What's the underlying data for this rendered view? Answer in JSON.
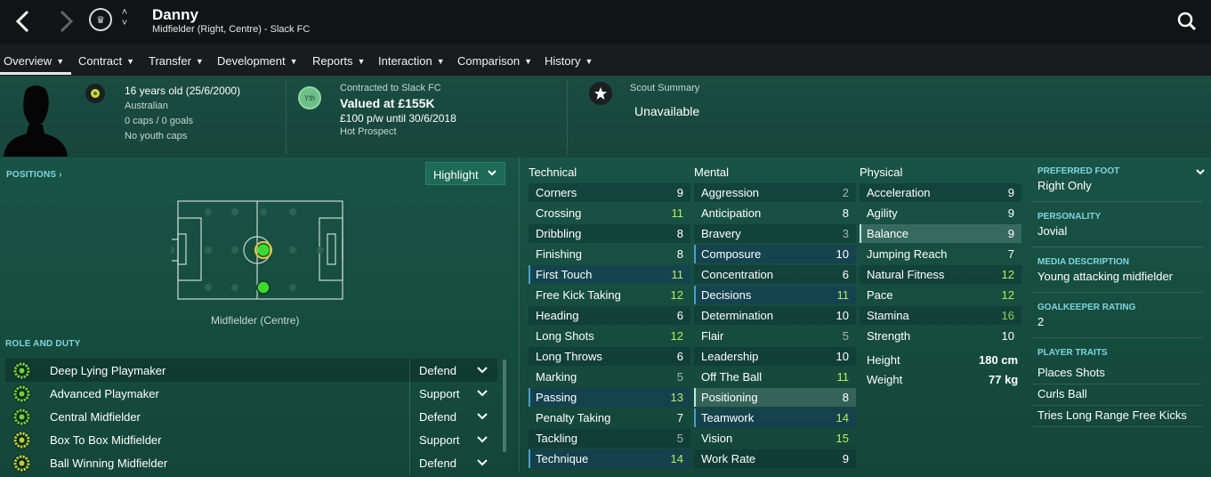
{
  "header": {
    "name": "Danny",
    "subtitle": "Midfielder (Right, Centre) - Slack FC"
  },
  "menu": [
    {
      "label": "Overview"
    },
    {
      "label": "Contract"
    },
    {
      "label": "Transfer"
    },
    {
      "label": "Development"
    },
    {
      "label": "Reports"
    },
    {
      "label": "Interaction"
    },
    {
      "label": "Comparison"
    },
    {
      "label": "History"
    }
  ],
  "info": {
    "age": "16 years old (25/6/2000)",
    "nationality": "Australian",
    "caps": "0 caps / 0 goals",
    "youth_caps": "No youth caps",
    "yth_badge": "Yth",
    "contract_label": "Contracted to Slack FC",
    "value": "Valued at £155K",
    "wage": "£100 p/w until 30/6/2018",
    "status": "Hot Prospect",
    "scout_label": "Scout Summary",
    "scout_value": "Unavailable"
  },
  "positions": {
    "title": "POSITIONS",
    "highlight_label": "Highlight",
    "position_label": "Midfielder (Centre)"
  },
  "roles": {
    "title": "ROLE AND DUTY",
    "items": [
      {
        "role": "Deep Lying Playmaker",
        "duty": "Defend"
      },
      {
        "role": "Advanced Playmaker",
        "duty": "Support"
      },
      {
        "role": "Central Midfielder",
        "duty": "Defend"
      },
      {
        "role": "Box To Box Midfielder",
        "duty": "Support"
      },
      {
        "role": "Ball Winning Midfielder",
        "duty": "Defend"
      }
    ]
  },
  "attributes": {
    "technical_title": "Technical",
    "mental_title": "Mental",
    "physical_title": "Physical",
    "technical": [
      {
        "name": "Corners",
        "value": "9"
      },
      {
        "name": "Crossing",
        "value": "11"
      },
      {
        "name": "Dribbling",
        "value": "8"
      },
      {
        "name": "Finishing",
        "value": "8"
      },
      {
        "name": "First Touch",
        "value": "11"
      },
      {
        "name": "Free Kick Taking",
        "value": "12"
      },
      {
        "name": "Heading",
        "value": "6"
      },
      {
        "name": "Long Shots",
        "value": "12"
      },
      {
        "name": "Long Throws",
        "value": "6"
      },
      {
        "name": "Marking",
        "value": "5"
      },
      {
        "name": "Passing",
        "value": "13"
      },
      {
        "name": "Penalty Taking",
        "value": "7"
      },
      {
        "name": "Tackling",
        "value": "5"
      },
      {
        "name": "Technique",
        "value": "14"
      }
    ],
    "mental": [
      {
        "name": "Aggression",
        "value": "2"
      },
      {
        "name": "Anticipation",
        "value": "8"
      },
      {
        "name": "Bravery",
        "value": "3"
      },
      {
        "name": "Composure",
        "value": "10"
      },
      {
        "name": "Concentration",
        "value": "6"
      },
      {
        "name": "Decisions",
        "value": "11"
      },
      {
        "name": "Determination",
        "value": "10"
      },
      {
        "name": "Flair",
        "value": "5"
      },
      {
        "name": "Leadership",
        "value": "10"
      },
      {
        "name": "Off The Ball",
        "value": "11"
      },
      {
        "name": "Positioning",
        "value": "8"
      },
      {
        "name": "Teamwork",
        "value": "14"
      },
      {
        "name": "Vision",
        "value": "15"
      },
      {
        "name": "Work Rate",
        "value": "9"
      }
    ],
    "physical": [
      {
        "name": "Acceleration",
        "value": "9"
      },
      {
        "name": "Agility",
        "value": "9"
      },
      {
        "name": "Balance",
        "value": "9"
      },
      {
        "name": "Jumping Reach",
        "value": "7"
      },
      {
        "name": "Natural Fitness",
        "value": "12"
      },
      {
        "name": "Pace",
        "value": "12"
      },
      {
        "name": "Stamina",
        "value": "16"
      },
      {
        "name": "Strength",
        "value": "10"
      }
    ],
    "height_label": "Height",
    "height_value": "180 cm",
    "weight_label": "Weight",
    "weight_value": "77 kg"
  },
  "side_panel": {
    "preferred_foot_title": "PREFERRED FOOT",
    "preferred_foot": "Right Only",
    "personality_title": "PERSONALITY",
    "personality": "Jovial",
    "media_title": "MEDIA DESCRIPTION",
    "media": "Young attacking midfielder",
    "gk_title": "GOALKEEPER RATING",
    "gk_rating": "2",
    "traits_title": "PLAYER TRAITS",
    "traits": [
      "Places Shots",
      "Curls Ball",
      "Tries Long Range Free Kicks"
    ]
  },
  "colors": {
    "top_bar": "#121314",
    "accent_text": "#7fd5e0",
    "high_value": "#b9ec5a",
    "position_dot": "#3ddb2c"
  }
}
